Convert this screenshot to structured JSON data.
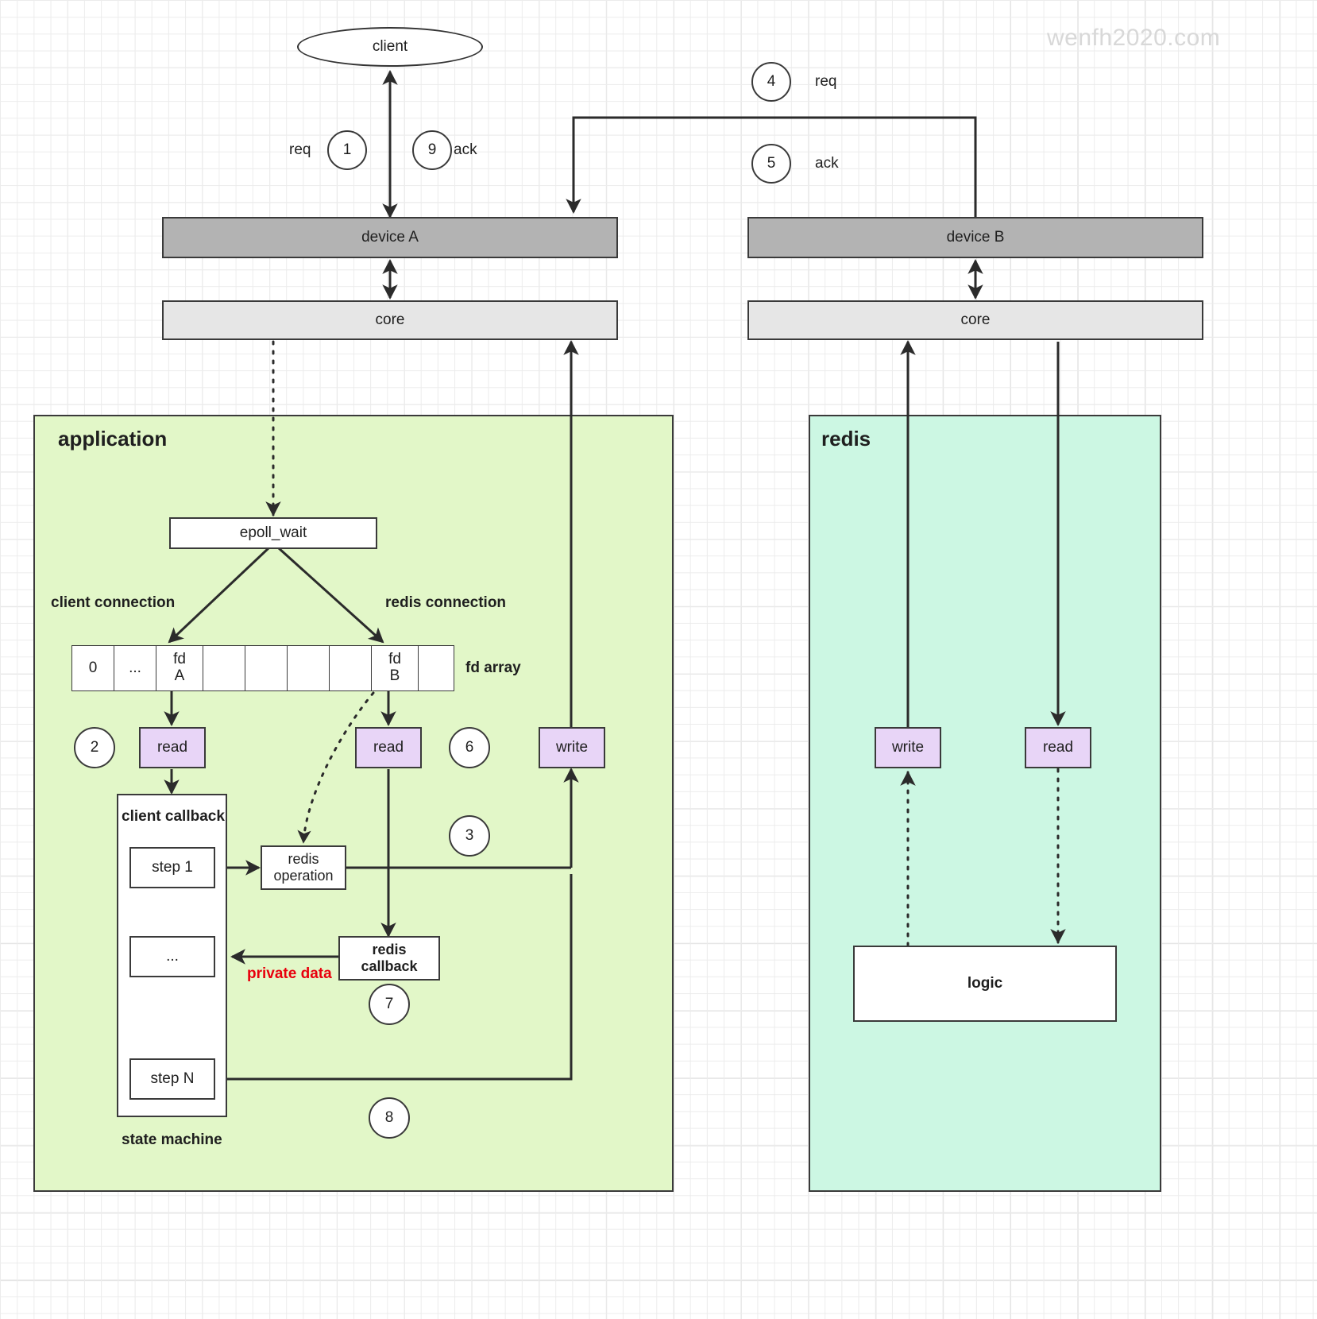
{
  "watermark": "wenfh2020.com",
  "client": {
    "label": "client"
  },
  "flow_markers": {
    "m1": {
      "num": "1",
      "label": "req"
    },
    "m9": {
      "num": "9",
      "label": "ack"
    },
    "m4": {
      "num": "4",
      "label": "req"
    },
    "m5": {
      "num": "5",
      "label": "ack"
    },
    "m2": {
      "num": "2"
    },
    "m6": {
      "num": "6"
    },
    "m3": {
      "num": "3"
    },
    "m7": {
      "num": "7"
    },
    "m8": {
      "num": "8"
    }
  },
  "kernel": {
    "device_a": "device A",
    "core_a": "core",
    "device_b": "device B",
    "core_b": "core"
  },
  "application": {
    "title": "application",
    "epoll_wait": "epoll_wait",
    "client_connection": "client connection",
    "redis_connection": "redis connection",
    "fd_array_label": "fd array",
    "fd_cells": [
      "0",
      "...",
      "fd\nA",
      "",
      "",
      "",
      "",
      "fd\nB",
      ""
    ],
    "read_client": "read",
    "read_redis": "read",
    "write": "write",
    "client_callback": "client callback",
    "steps": [
      "step 1",
      "...",
      "step N"
    ],
    "state_machine": "state machine",
    "redis_operation": "redis\noperation",
    "redis_callback": "redis\ncallback",
    "private_data": "private data"
  },
  "redis": {
    "title": "redis",
    "write": "write",
    "read": "read",
    "logic": "logic"
  },
  "colors": {
    "application_panel": "#e2f7c8",
    "redis_panel": "#ccf7e3",
    "device": "#b3b3b3",
    "core": "#e6e6e6",
    "io_box": "#e8d5f7",
    "stroke": "#3a3a3a",
    "private_data_text": "#e8000d",
    "watermark": "#d8d8d8"
  }
}
